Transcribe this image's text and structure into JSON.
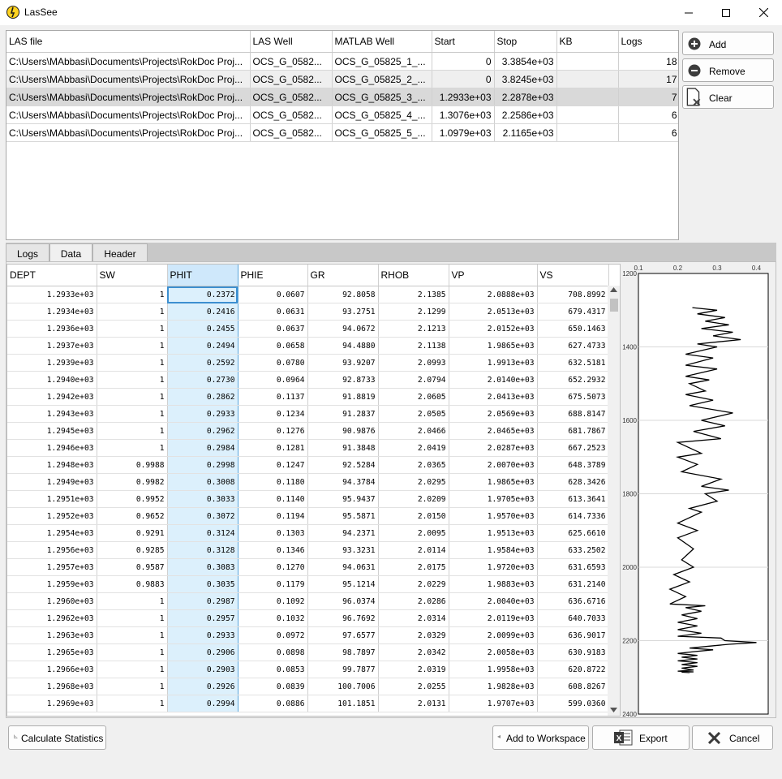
{
  "window": {
    "title": "LasSee",
    "minimize": "—",
    "maximize": "☐",
    "close": "✕"
  },
  "file_table": {
    "headers": [
      "LAS file",
      "LAS Well",
      "MATLAB Well",
      "Start",
      "Stop",
      "KB",
      "Logs"
    ],
    "rows": [
      [
        "C:\\Users\\MAbbasi\\Documents\\Projects\\RokDoc Proj...",
        "OCS_G_0582...",
        "OCS_G_05825_1_...",
        "0",
        "3.3854e+03",
        "",
        "18"
      ],
      [
        "C:\\Users\\MAbbasi\\Documents\\Projects\\RokDoc Proj...",
        "OCS_G_0582...",
        "OCS_G_05825_2_...",
        "0",
        "3.8245e+03",
        "",
        "17"
      ],
      [
        "C:\\Users\\MAbbasi\\Documents\\Projects\\RokDoc Proj...",
        "OCS_G_0582...",
        "OCS_G_05825_3_...",
        "1.2933e+03",
        "2.2878e+03",
        "",
        "7"
      ],
      [
        "C:\\Users\\MAbbasi\\Documents\\Projects\\RokDoc Proj...",
        "OCS_G_0582...",
        "OCS_G_05825_4_...",
        "1.3076e+03",
        "2.2586e+03",
        "",
        "6"
      ],
      [
        "C:\\Users\\MAbbasi\\Documents\\Projects\\RokDoc Proj...",
        "OCS_G_0582...",
        "OCS_G_05825_5_...",
        "1.0979e+03",
        "2.1165e+03",
        "",
        "6"
      ]
    ]
  },
  "side_buttons": {
    "add": "Add",
    "remove": "Remove",
    "clear": "Clear"
  },
  "tabs": [
    "Logs",
    "Data",
    "Header"
  ],
  "data_table": {
    "headers": [
      "DEPT",
      "SW",
      "PHIT",
      "PHIE",
      "GR",
      "RHOB",
      "VP",
      "VS"
    ],
    "rows": [
      [
        "1.2933e+03",
        "1",
        "0.2372",
        "0.0607",
        "92.8058",
        "2.1385",
        "2.0888e+03",
        "708.8992"
      ],
      [
        "1.2934e+03",
        "1",
        "0.2416",
        "0.0631",
        "93.2751",
        "2.1299",
        "2.0513e+03",
        "679.4317"
      ],
      [
        "1.2936e+03",
        "1",
        "0.2455",
        "0.0637",
        "94.0672",
        "2.1213",
        "2.0152e+03",
        "650.1463"
      ],
      [
        "1.2937e+03",
        "1",
        "0.2494",
        "0.0658",
        "94.4880",
        "2.1138",
        "1.9865e+03",
        "627.4733"
      ],
      [
        "1.2939e+03",
        "1",
        "0.2592",
        "0.0780",
        "93.9207",
        "2.0993",
        "1.9913e+03",
        "632.5181"
      ],
      [
        "1.2940e+03",
        "1",
        "0.2730",
        "0.0964",
        "92.8733",
        "2.0794",
        "2.0140e+03",
        "652.2932"
      ],
      [
        "1.2942e+03",
        "1",
        "0.2862",
        "0.1137",
        "91.8819",
        "2.0605",
        "2.0413e+03",
        "675.5073"
      ],
      [
        "1.2943e+03",
        "1",
        "0.2933",
        "0.1234",
        "91.2837",
        "2.0505",
        "2.0569e+03",
        "688.8147"
      ],
      [
        "1.2945e+03",
        "1",
        "0.2962",
        "0.1276",
        "90.9876",
        "2.0466",
        "2.0465e+03",
        "681.7867"
      ],
      [
        "1.2946e+03",
        "1",
        "0.2984",
        "0.1281",
        "91.3848",
        "2.0419",
        "2.0287e+03",
        "667.2523"
      ],
      [
        "1.2948e+03",
        "0.9988",
        "0.2998",
        "0.1247",
        "92.5284",
        "2.0365",
        "2.0070e+03",
        "648.3789"
      ],
      [
        "1.2949e+03",
        "0.9982",
        "0.3008",
        "0.1180",
        "94.3784",
        "2.0295",
        "1.9865e+03",
        "628.3426"
      ],
      [
        "1.2951e+03",
        "0.9952",
        "0.3033",
        "0.1140",
        "95.9437",
        "2.0209",
        "1.9705e+03",
        "613.3641"
      ],
      [
        "1.2952e+03",
        "0.9652",
        "0.3072",
        "0.1194",
        "95.5871",
        "2.0150",
        "1.9570e+03",
        "614.7336"
      ],
      [
        "1.2954e+03",
        "0.9291",
        "0.3124",
        "0.1303",
        "94.2371",
        "2.0095",
        "1.9513e+03",
        "625.6610"
      ],
      [
        "1.2956e+03",
        "0.9285",
        "0.3128",
        "0.1346",
        "93.3231",
        "2.0114",
        "1.9584e+03",
        "633.2502"
      ],
      [
        "1.2957e+03",
        "0.9587",
        "0.3083",
        "0.1270",
        "94.0631",
        "2.0175",
        "1.9720e+03",
        "631.6593"
      ],
      [
        "1.2959e+03",
        "0.9883",
        "0.3035",
        "0.1179",
        "95.1214",
        "2.0229",
        "1.9883e+03",
        "631.2140"
      ],
      [
        "1.2960e+03",
        "1",
        "0.2987",
        "0.1092",
        "96.0374",
        "2.0286",
        "2.0040e+03",
        "636.6716"
      ],
      [
        "1.2962e+03",
        "1",
        "0.2957",
        "0.1032",
        "96.7692",
        "2.0314",
        "2.0119e+03",
        "640.7033"
      ],
      [
        "1.2963e+03",
        "1",
        "0.2933",
        "0.0972",
        "97.6577",
        "2.0329",
        "2.0099e+03",
        "636.9017"
      ],
      [
        "1.2965e+03",
        "1",
        "0.2906",
        "0.0898",
        "98.7897",
        "2.0342",
        "2.0058e+03",
        "630.9183"
      ],
      [
        "1.2966e+03",
        "1",
        "0.2903",
        "0.0853",
        "99.7877",
        "2.0319",
        "1.9958e+03",
        "620.8722"
      ],
      [
        "1.2968e+03",
        "1",
        "0.2926",
        "0.0839",
        "100.7006",
        "2.0255",
        "1.9828e+03",
        "608.8267"
      ],
      [
        "1.2969e+03",
        "1",
        "0.2994",
        "0.0886",
        "101.1851",
        "2.0131",
        "1.9707e+03",
        "599.0360"
      ]
    ]
  },
  "chart_data": {
    "type": "line",
    "title": "",
    "xlabel": "",
    "ylabel": "",
    "xlim": [
      0.1,
      0.43
    ],
    "ylim": [
      1200,
      2400
    ],
    "y_reversed": true,
    "x_ticks": [
      "0.1",
      "0.2",
      "0.3",
      "0.4"
    ],
    "y_ticks": [
      "1200",
      "1400",
      "1600",
      "1800",
      "2000",
      "2200",
      "2400"
    ],
    "grid": true,
    "series": [
      {
        "color": "#000000",
        "x": [
          0.2372,
          0.3,
          0.25,
          0.32,
          0.27,
          0.33,
          0.26,
          0.34,
          0.29,
          0.36,
          0.25,
          0.3,
          0.22,
          0.29,
          0.22,
          0.3,
          0.22,
          0.28,
          0.23,
          0.27,
          0.22,
          0.29,
          0.23,
          0.34,
          0.26,
          0.32,
          0.24,
          0.31,
          0.2,
          0.26,
          0.2,
          0.25,
          0.21,
          0.31,
          0.26,
          0.33,
          0.27,
          0.3,
          0.23,
          0.26,
          0.2,
          0.25,
          0.2,
          0.24,
          0.21,
          0.24,
          0.19,
          0.23,
          0.18,
          0.22,
          0.18,
          0.27,
          0.22,
          0.26,
          0.21,
          0.25,
          0.2,
          0.25,
          0.2,
          0.26,
          0.2,
          0.31,
          0.32,
          0.4,
          0.33,
          0.28,
          0.23,
          0.29,
          0.24,
          0.2,
          0.25,
          0.21,
          0.25,
          0.2,
          0.25,
          0.21,
          0.25,
          0.21,
          0.24,
          0.2,
          0.24,
          0.21,
          0.23
        ],
        "y": [
          1293,
          1300,
          1310,
          1320,
          1330,
          1340,
          1350,
          1360,
          1370,
          1380,
          1392,
          1400,
          1420,
          1430,
          1450,
          1460,
          1480,
          1490,
          1500,
          1520,
          1530,
          1545,
          1560,
          1580,
          1600,
          1615,
          1630,
          1650,
          1660,
          1690,
          1700,
          1720,
          1740,
          1760,
          1780,
          1790,
          1800,
          1820,
          1840,
          1850,
          1880,
          1900,
          1920,
          1950,
          1980,
          2000,
          2020,
          2040,
          2060,
          2080,
          2100,
          2105,
          2110,
          2120,
          2130,
          2140,
          2150,
          2160,
          2170,
          2180,
          2188,
          2193,
          2200,
          2205,
          2210,
          2215,
          2220,
          2225,
          2230,
          2235,
          2240,
          2245,
          2250,
          2255,
          2260,
          2265,
          2270,
          2275,
          2280,
          2283,
          2285,
          2286,
          2287
        ]
      }
    ]
  },
  "bottom_buttons": {
    "calc_stats": "Calculate Statistics",
    "add_workspace": "Add to Workspace",
    "export": "Export",
    "cancel": "Cancel"
  },
  "colors": {
    "selection": "#dcf0fc",
    "selection_border": "#3c8fd0",
    "row_selected": "#d9d9d9"
  }
}
